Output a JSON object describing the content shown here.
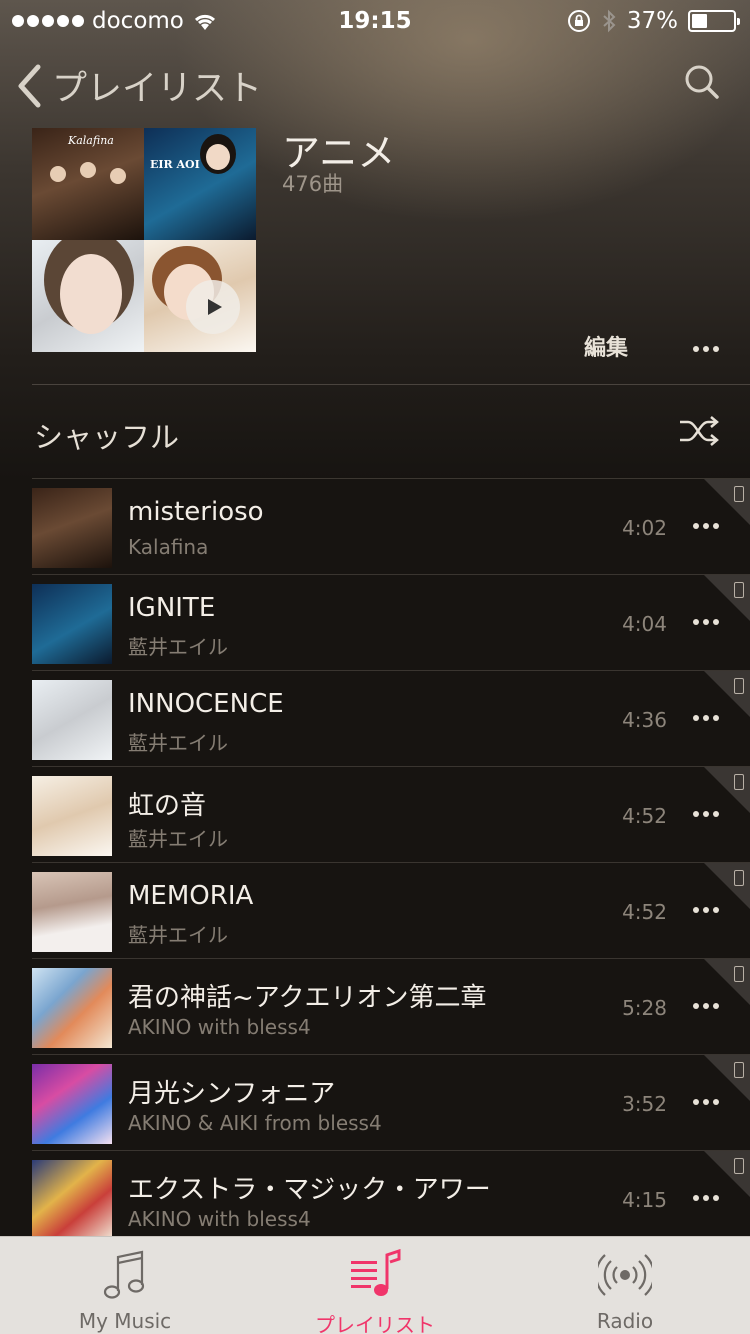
{
  "status_bar": {
    "carrier": "docomo",
    "time": "19:15",
    "battery": "37%",
    "battery_level": 0.37
  },
  "nav": {
    "back_label": "プレイリスト",
    "back_icon": "chevron-left-icon",
    "search_icon": "search-icon"
  },
  "playlist": {
    "title": "アニメ",
    "count": "476曲",
    "edit_label": "編集",
    "shuffle_label": "シャッフル"
  },
  "songs": [
    {
      "title": "misterioso",
      "artist": "Kalafina",
      "duration": "4:02"
    },
    {
      "title": "IGNITE",
      "artist": "藍井エイル",
      "duration": "4:04"
    },
    {
      "title": "INNOCENCE",
      "artist": "藍井エイル",
      "duration": "4:36"
    },
    {
      "title": "虹の音",
      "artist": "藍井エイル",
      "duration": "4:52"
    },
    {
      "title": "MEMORIA",
      "artist": "藍井エイル",
      "duration": "4:52"
    },
    {
      "title": "君の神話~アクエリオン第二章",
      "artist": "AKINO with bless4",
      "duration": "5:28"
    },
    {
      "title": "月光シンフォニア",
      "artist": "AKINO & AIKI from bless4",
      "duration": "3:52"
    },
    {
      "title": "エクストラ・マジック・アワー",
      "artist": "AKINO with bless4",
      "duration": "4:15"
    }
  ],
  "tabs": [
    {
      "label": "My Music",
      "icon": "music-note-icon",
      "active": false
    },
    {
      "label": "プレイリスト",
      "icon": "playlist-icon",
      "active": true
    },
    {
      "label": "Radio",
      "icon": "radio-icon",
      "active": false
    }
  ],
  "colors": {
    "accent": "#f0356a",
    "background": "#171411",
    "secondary_text": "#857d73"
  }
}
